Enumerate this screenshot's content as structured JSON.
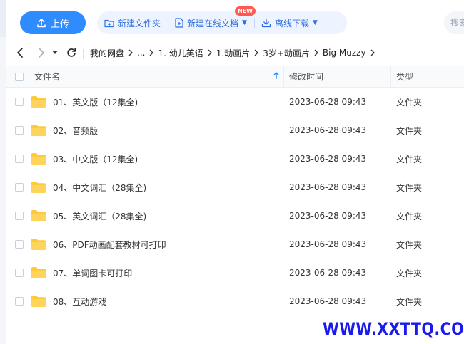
{
  "toolbar": {
    "upload_label": "上传",
    "new_folder_label": "新建文件夹",
    "new_online_doc_label": "新建在线文档",
    "new_badge": "NEW",
    "offline_download_label": "离线下载",
    "search_placeholder": "搜索"
  },
  "breadcrumb": [
    "我的网盘",
    "...",
    "1. 幼儿英语",
    "1.动画片",
    "3岁+动画片",
    "Big Muzzy"
  ],
  "table": {
    "columns": {
      "name": "文件名",
      "modified": "修改时间",
      "type": "类型"
    },
    "rows": [
      {
        "name": "01、英文版（12集全)",
        "modified": "2023-06-28 09:43",
        "type": "文件夹"
      },
      {
        "name": "02、音频版",
        "modified": "2023-06-28 09:43",
        "type": "文件夹"
      },
      {
        "name": "03、中文版（12集全)",
        "modified": "2023-06-28 09:43",
        "type": "文件夹"
      },
      {
        "name": "04、中文词汇（28集全)",
        "modified": "2023-06-28 09:43",
        "type": "文件夹"
      },
      {
        "name": "05、英文词汇（28集全)",
        "modified": "2023-06-28 09:43",
        "type": "文件夹"
      },
      {
        "name": "06、PDF动画配套教材可打印",
        "modified": "2023-06-28 09:43",
        "type": "文件夹"
      },
      {
        "name": "07、单词图卡可打印",
        "modified": "2023-06-28 09:43",
        "type": "文件夹"
      },
      {
        "name": "08、互动游戏",
        "modified": "2023-06-28 09:43",
        "type": "文件夹"
      }
    ]
  },
  "watermark": "WWW.XXTTQ.COM",
  "colors": {
    "accent": "#2f8cff",
    "folder": "#ffc83d",
    "watermark": "#1a1aee",
    "badge": "#ff5a4f"
  }
}
